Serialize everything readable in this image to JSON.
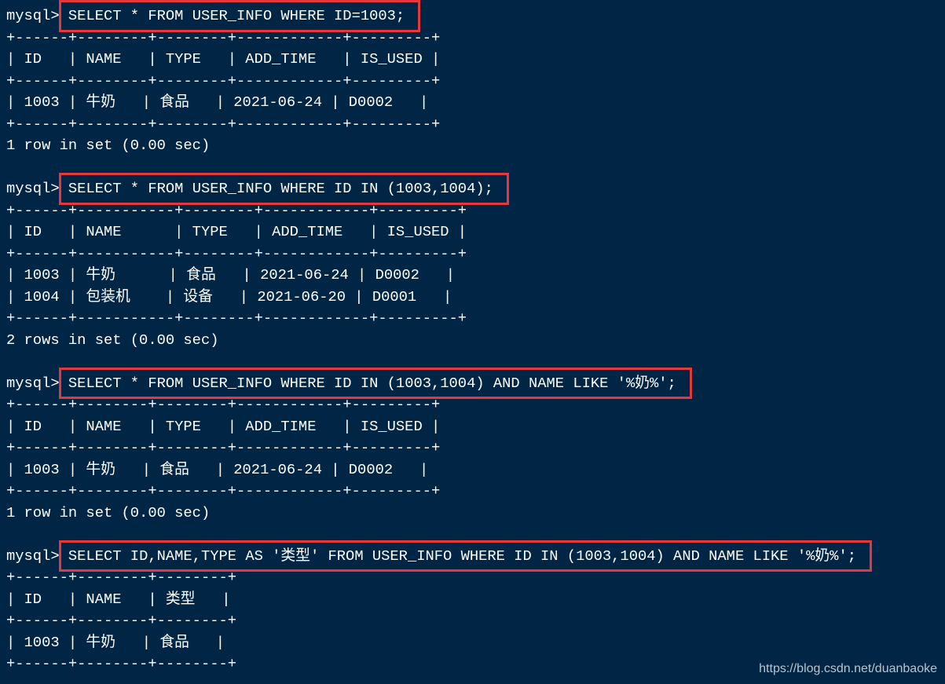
{
  "terminal": {
    "prompt": "mysql> ",
    "queries": [
      {
        "command": "SELECT * FROM USER_INFO WHERE ID=1003;",
        "border": "+------+--------+--------+------------+---------+",
        "header": "| ID   | NAME   | TYPE   | ADD_TIME   | IS_USED |",
        "columns": [
          "ID",
          "NAME",
          "TYPE",
          "ADD_TIME",
          "IS_USED"
        ],
        "rows_text": [
          "| 1003 | 牛奶   | 食品   | 2021-06-24 | D0002   |"
        ],
        "rows": [
          [
            "1003",
            "牛奶",
            "食品",
            "2021-06-24",
            "D0002"
          ]
        ],
        "status": "1 row in set (0.00 sec)"
      },
      {
        "command": "SELECT * FROM USER_INFO WHERE ID IN (1003,1004);",
        "border": "+------+-----------+--------+------------+---------+",
        "header": "| ID   | NAME      | TYPE   | ADD_TIME   | IS_USED |",
        "columns": [
          "ID",
          "NAME",
          "TYPE",
          "ADD_TIME",
          "IS_USED"
        ],
        "rows_text": [
          "| 1003 | 牛奶      | 食品   | 2021-06-24 | D0002   |",
          "| 1004 | 包装机    | 设备   | 2021-06-20 | D0001   |"
        ],
        "rows": [
          [
            "1003",
            "牛奶",
            "食品",
            "2021-06-24",
            "D0002"
          ],
          [
            "1004",
            "包装机",
            "设备",
            "2021-06-20",
            "D0001"
          ]
        ],
        "status": "2 rows in set (0.00 sec)"
      },
      {
        "command": "SELECT * FROM USER_INFO WHERE ID IN (1003,1004) AND NAME LIKE '%奶%';",
        "border": "+------+--------+--------+------------+---------+",
        "header": "| ID   | NAME   | TYPE   | ADD_TIME   | IS_USED |",
        "columns": [
          "ID",
          "NAME",
          "TYPE",
          "ADD_TIME",
          "IS_USED"
        ],
        "rows_text": [
          "| 1003 | 牛奶   | 食品   | 2021-06-24 | D0002   |"
        ],
        "rows": [
          [
            "1003",
            "牛奶",
            "食品",
            "2021-06-24",
            "D0002"
          ]
        ],
        "status": "1 row in set (0.00 sec)"
      },
      {
        "command": "SELECT ID,NAME,TYPE AS '类型' FROM USER_INFO WHERE ID IN (1003,1004) AND NAME LIKE '%奶%';",
        "border": "+------+--------+--------+",
        "header": "| ID   | NAME   | 类型   |",
        "columns": [
          "ID",
          "NAME",
          "类型"
        ],
        "rows_text": [
          "| 1003 | 牛奶   | 食品   |"
        ],
        "rows": [
          [
            "1003",
            "牛奶",
            "食品"
          ]
        ],
        "status": ""
      }
    ]
  },
  "watermark": "https://blog.csdn.net/duanbaoke",
  "colors": {
    "background": "#012645",
    "text": "#ffffff",
    "highlight_box": "#e8373b",
    "watermark": "#b9c3cd"
  }
}
